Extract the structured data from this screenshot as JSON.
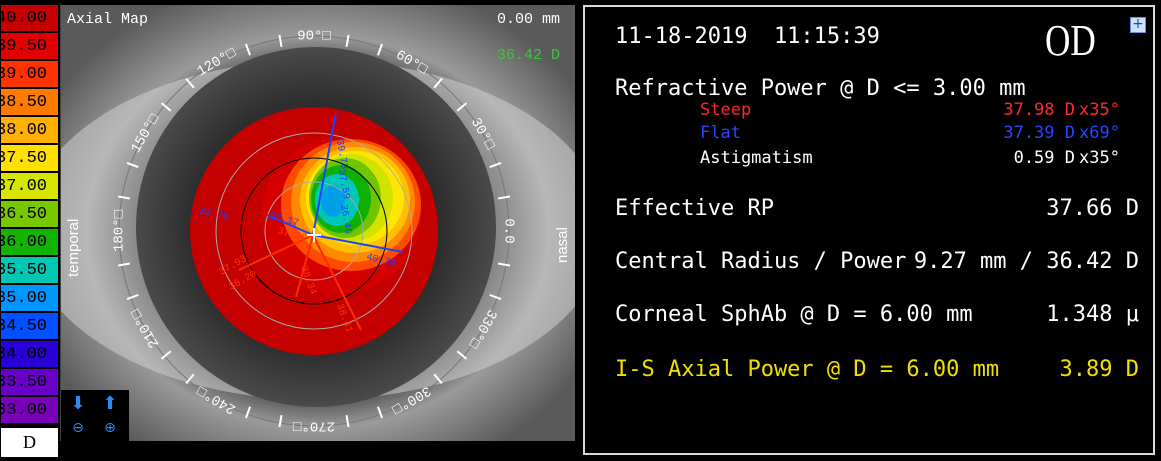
{
  "scale": {
    "entries": [
      {
        "label": "40.00",
        "color": "#c50000"
      },
      {
        "label": "39.50",
        "color": "#e00000"
      },
      {
        "label": "39.00",
        "color": "#ff3300"
      },
      {
        "label": "38.50",
        "color": "#ff7a00"
      },
      {
        "label": "38.00",
        "color": "#ffb000"
      },
      {
        "label": "37.50",
        "color": "#ffe000"
      },
      {
        "label": "37.00",
        "color": "#d6e600"
      },
      {
        "label": "36.50",
        "color": "#78c800"
      },
      {
        "label": "36.00",
        "color": "#11b400"
      },
      {
        "label": "35.50",
        "color": "#00c8b4"
      },
      {
        "label": "35.00",
        "color": "#0096ff"
      },
      {
        "label": "34.50",
        "color": "#0050ff"
      },
      {
        "label": "34.00",
        "color": "#2a00d8"
      },
      {
        "label": "33.50",
        "color": "#6a00c8"
      },
      {
        "label": "33.00",
        "color": "#7800b8"
      }
    ],
    "unit": "D"
  },
  "map": {
    "title": "Axial Map",
    "mm_readout": "0.00 mm",
    "power_readout": "36.42 D",
    "label_temporal": "temporal",
    "label_nasal": "nasal",
    "angle_labels": [
      "0.0",
      "30°□",
      "60°□",
      "90°□",
      "120°□",
      "150°□",
      "180°□",
      "210°□",
      "240°□",
      "270°□",
      "300°□",
      "330°□"
    ],
    "annotations": [
      {
        "text": "32.76",
        "color": "#1f3fff"
      },
      {
        "text": "37.17",
        "color": "#1f3fff"
      },
      {
        "text": "37.29",
        "color": "#ff3300"
      },
      {
        "text": "38.34",
        "color": "#ff3300"
      },
      {
        "text": "37.93",
        "color": "#ff3300"
      },
      {
        "text": "38.20",
        "color": "#ff3300"
      },
      {
        "text": "38.41",
        "color": "#ff3300"
      },
      {
        "text": "39.73",
        "color": "#1f3fff"
      },
      {
        "text": "37.59",
        "color": "#1f3fff"
      },
      {
        "text": "36.46",
        "color": "#1f3fff"
      },
      {
        "text": "40.70",
        "color": "#1f3fff"
      }
    ]
  },
  "panel": {
    "datetime": "11-18-2019  11:15:39",
    "eye": "OD",
    "expand_icon": "+",
    "refractive_title": "Refractive Power @ D <= 3.00 mm",
    "steep_label": "Steep",
    "steep_value": "37.98 D",
    "steep_axis": "x35°",
    "flat_label": "Flat",
    "flat_value": "37.39 D",
    "flat_axis": "x69°",
    "astig_label": "Astigmatism",
    "astig_value": "0.59 D",
    "astig_axis": "x35°",
    "effective_label": "Effective RP",
    "effective_value": "37.66 D",
    "central_label": "Central Radius / Power",
    "central_value": "9.27 mm / 36.42 D",
    "sphab_label": "Corneal SphAb @ D = 6.00 mm",
    "sphab_value": "1.348 μ",
    "is_label": "I-S Axial Power @ D = 6.00 mm",
    "is_value": "3.89 D",
    "colors": {
      "steep": "#ff2a2a",
      "flat": "#2a44ff",
      "highlight": "#f0e000",
      "text": "#ffffff"
    }
  }
}
